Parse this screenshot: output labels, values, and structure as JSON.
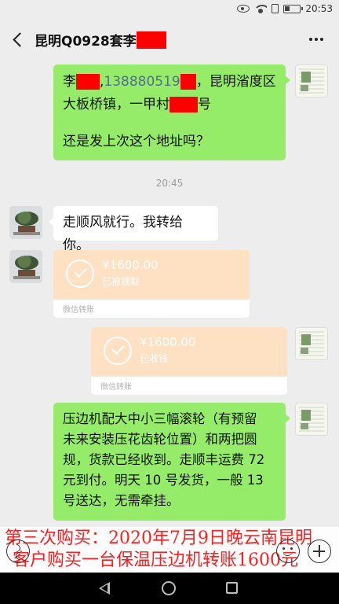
{
  "status_bar": {
    "time": "20:53"
  },
  "header": {
    "title": "昆明Q0928套李"
  },
  "messages": [
    {
      "from": "me",
      "line1": {
        "surname": "李",
        "sep": ",",
        "phone": "138880519",
        "after": "，昆明渻度区"
      },
      "line2": "大板桥镇，一甲村",
      "line2_suffix": "号",
      "line3": "还是发上次这个地址吗？"
    },
    {
      "type": "time",
      "text": "20:45"
    },
    {
      "from": "them",
      "text": "走顺风就行。我转给你。"
    },
    {
      "from": "them",
      "type": "transfer",
      "amount": "¥1600.00",
      "status": "已被领取",
      "footer": "微信转账"
    },
    {
      "from": "me",
      "type": "transfer",
      "amount": "¥1600.00",
      "status": "已收钱",
      "footer": "微信转账"
    },
    {
      "from": "me",
      "lines": [
        "压边机配大中小三幅滚轮（有预留",
        "未来安装压花齿轮位置）和两把圆",
        "规，货款已经收到。走顺丰运费 72",
        "元到付。明天 10 号发货，一般 13",
        "号送达，无需牵挂。"
      ]
    }
  ],
  "caption": {
    "line1": "第三次购买：2020年7月9日晚云南昆明",
    "line2": "客户购买一台保温压边机转账1600元"
  },
  "colors": {
    "my_bubble": "#95ec69",
    "transfer_card": "#fde1c2",
    "caption_text": "#ff1e1e",
    "redaction": "#ff0000"
  }
}
